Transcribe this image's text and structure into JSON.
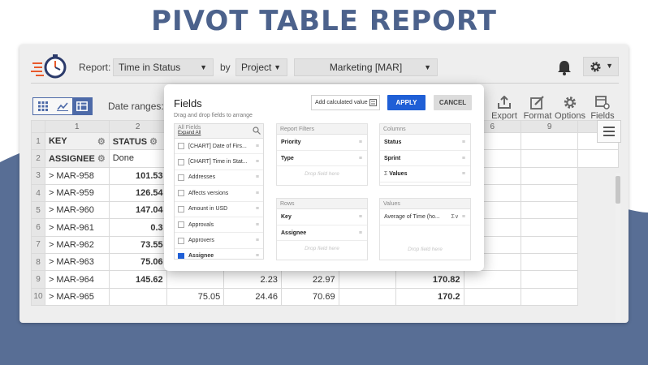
{
  "headline": "PIVOT TABLE REPORT",
  "colors": {
    "headline": "#4c628c",
    "accent": "#4d6aa8",
    "apply": "#1f5fd6",
    "wave": "#586e95"
  },
  "topbar": {
    "report_label": "Report:",
    "report_value": "Time in Status",
    "by_label": "by",
    "group_value": "Project",
    "project_value": "Marketing [MAR]",
    "icons": [
      "timer-logo-icon",
      "bell-icon",
      "gear-icon"
    ]
  },
  "toolbar": {
    "date_ranges_label": "Date ranges:",
    "view_icons": [
      "grid-view-icon",
      "chart-view-icon",
      "pivot-view-icon"
    ],
    "export_label": "Export",
    "format_label": "Format",
    "options_label": "Options",
    "fields_label": "Fields"
  },
  "grid": {
    "col_numbers": [
      "1",
      "2",
      "",
      "",
      "",
      "",
      "6",
      "9"
    ],
    "row_numbers": [
      "1",
      "2",
      "3",
      "4",
      "5",
      "6",
      "7",
      "8",
      "9",
      "10"
    ],
    "header_key": "KEY",
    "header_status": "STATUS",
    "assignee_label": "ASSIGNEE",
    "status_done": "Done",
    "rows": [
      {
        "key": "MAR-958",
        "c1": "101.53",
        "c2": "",
        "c3": "",
        "c4": "",
        "c5": "",
        "c6": ""
      },
      {
        "key": "MAR-959",
        "c1": "126.54",
        "c2": "",
        "c3": "",
        "c4": "",
        "c5": "",
        "c6": ""
      },
      {
        "key": "MAR-960",
        "c1": "147.04",
        "c2": "",
        "c3": "",
        "c4": "",
        "c5": "",
        "c6": ""
      },
      {
        "key": "MAR-961",
        "c1": "0.3",
        "c2": "",
        "c3": "",
        "c4": "",
        "c5": "",
        "c6": ""
      },
      {
        "key": "MAR-962",
        "c1": "73.55",
        "c2": "",
        "c3": "",
        "c4": "",
        "c5": "",
        "c6": ""
      },
      {
        "key": "MAR-963",
        "c1": "75.06",
        "c2": "",
        "c3": "",
        "c4": "",
        "c5": "",
        "c6": ""
      },
      {
        "key": "MAR-964",
        "c1": "145.62",
        "c2": "",
        "c3": "2.23",
        "c4": "22.97",
        "c5": "",
        "c6": "170.82"
      },
      {
        "key": "MAR-965",
        "c1": "",
        "c2": "75.05",
        "c3": "24.46",
        "c4": "70.69",
        "c5": "",
        "c6": "170.2"
      }
    ]
  },
  "modal": {
    "title": "Fields",
    "subtitle": "Drag and drop fields to arrange",
    "add_calc_label": "Add calculated value",
    "apply_label": "APPLY",
    "cancel_label": "CANCEL",
    "all_fields_label": "All Fields",
    "expand_all_label": "Expand All",
    "fields": [
      {
        "label": "[CHART] Date of Firs...",
        "checked": false
      },
      {
        "label": "[CHART] Time in Stat...",
        "checked": false
      },
      {
        "label": "Addresses",
        "checked": false
      },
      {
        "label": "Affects versions",
        "checked": false
      },
      {
        "label": "Amount in USD",
        "checked": false
      },
      {
        "label": "Approvals",
        "checked": false
      },
      {
        "label": "Approvers",
        "checked": false
      },
      {
        "label": "Assignee",
        "checked": true
      }
    ],
    "report_filters": {
      "label": "Report Filters",
      "items": [
        "Priority",
        "Type"
      ],
      "drop": "Drop field here"
    },
    "columns": {
      "label": "Columns",
      "items": [
        "Status",
        "Sprint",
        "Values"
      ]
    },
    "rows": {
      "label": "Rows",
      "items": [
        "Key",
        "Assignee"
      ],
      "drop": "Drop field here"
    },
    "values": {
      "label": "Values",
      "items": [
        "Average of Time (ho..."
      ],
      "drop": "Drop field here"
    }
  }
}
